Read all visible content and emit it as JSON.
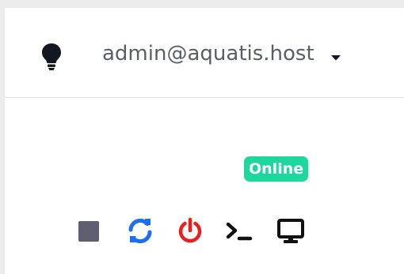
{
  "header": {
    "user_email": "admin@aquatis.host",
    "theme_toggle_icon": "lightbulb-icon",
    "dropdown_icon": "caret-down-icon"
  },
  "server": {
    "status": "Online",
    "status_color": "#1ed79c"
  },
  "actions": [
    {
      "name": "stop",
      "icon": "stop-icon",
      "color": "#5f5e70"
    },
    {
      "name": "restart",
      "icon": "sync-icon",
      "color": "#1b6ff2"
    },
    {
      "name": "power",
      "icon": "power-icon",
      "color": "#ef1e1e"
    },
    {
      "name": "console",
      "icon": "terminal-icon",
      "color": "#111111"
    },
    {
      "name": "desktop",
      "icon": "monitor-icon",
      "color": "#111111"
    }
  ]
}
